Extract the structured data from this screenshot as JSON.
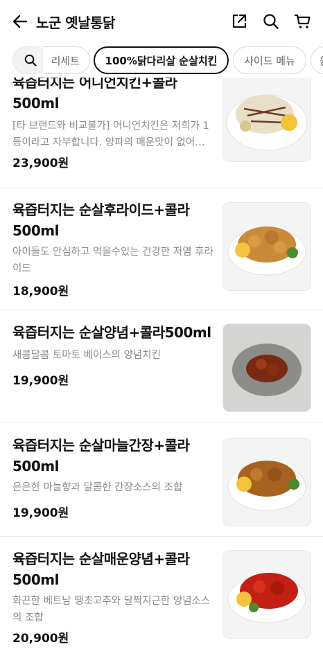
{
  "header": {
    "title": "노군 옛날통닭"
  },
  "chips": [
    {
      "label": "",
      "icon": "search-icon"
    },
    {
      "label": "리세트"
    },
    {
      "label": "100%닭다리살 순살치킨"
    },
    {
      "label": "사이드 메뉴"
    },
    {
      "label": "음"
    }
  ],
  "menu": [
    {
      "name": "육즙터지는 어니언치킨+콜라500ml",
      "desc": "[타 브랜드와 비교불가] 어니언치킨은 저희가 1등이라고 자부합니다. 양파의 매운맛이 없어…",
      "price": "23,900원"
    },
    {
      "name": "육즙터지는 순살후라이드+콜라500ml",
      "desc": "아이들도 안심하고 먹을수있는 건강한 저염 후라이드",
      "price": "18,900원"
    },
    {
      "name": "육즙터지는 순살양념+콜라500ml",
      "desc": "새콤달콤 토마토 베이스의 양념치킨",
      "price": "19,900원"
    },
    {
      "name": "육즙터지는 순살마늘간장+콜라500ml",
      "desc": "은은한 마늘향과 달콤한 간장소스의 조합",
      "price": "19,900원"
    },
    {
      "name": "육즙터지는 순살매운양념+콜라500ml",
      "desc": "화끈한 베트남 땡초고추와 달짝지근한 양념소스의 조합",
      "price": "20,900원"
    }
  ]
}
